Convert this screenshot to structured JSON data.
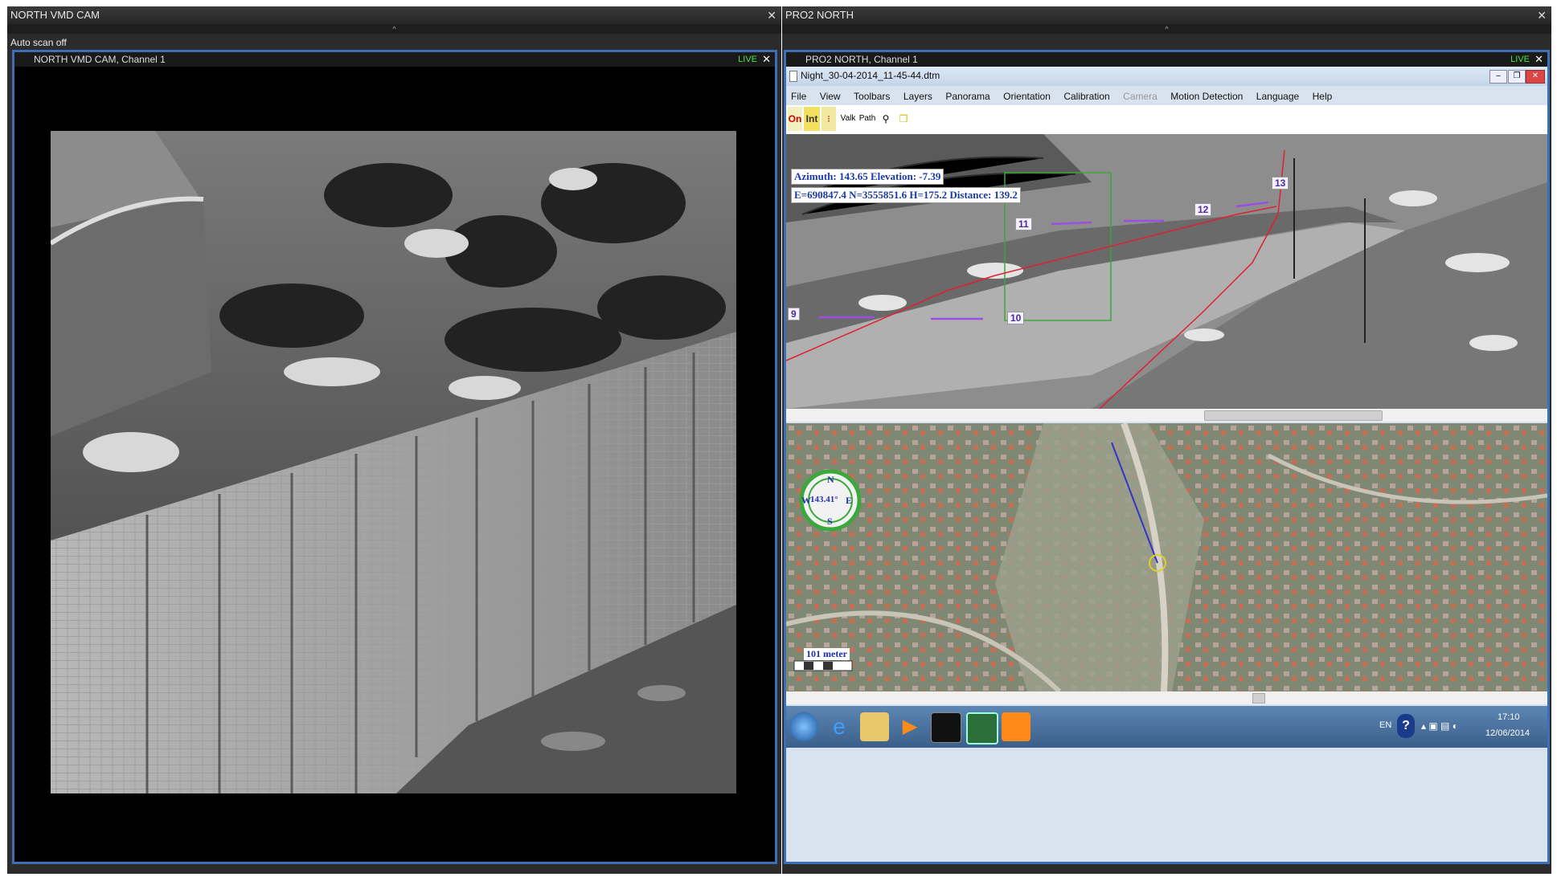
{
  "left_panel": {
    "title": "NORTH VMD CAM",
    "status": "Auto scan off",
    "channel_title": "NORTH VMD CAM, Channel  1",
    "live": "LIVE"
  },
  "right_panel": {
    "title": "PRO2 NORTH",
    "channel_title": "PRO2 NORTH, Channel  1",
    "live": "LIVE",
    "app": {
      "window_title": "Night_30-04-2014_11-45-44.dtm",
      "menu": [
        "File",
        "View",
        "Toolbars",
        "Layers",
        "Panorama",
        "Orientation",
        "Calibration",
        "Camera",
        "Motion Detection",
        "Language",
        "Help"
      ],
      "toolbar": {
        "on": "On",
        "int": "Int",
        "walk": "Valk",
        "path": "Path"
      },
      "readout": {
        "line1": "Azimuth: 143.65 Elevation: -7.39",
        "line2": "E=690847.4  N=3555851.6  H=175.2  Distance: 139.2"
      },
      "markers": [
        "9",
        "10",
        "11",
        "12",
        "13"
      ],
      "compass": {
        "n": "N",
        "s": "S",
        "w": "W",
        "e": "E",
        "bearing": "143.41°"
      },
      "scale": "101 meter"
    }
  },
  "taskbar": {
    "lang": "EN",
    "time": "17:10",
    "date": "12/06/2014"
  },
  "colors": {
    "frame": "#3d6fb5",
    "live": "#49e349",
    "path": "#e02030",
    "zone": "#3aa83a"
  }
}
